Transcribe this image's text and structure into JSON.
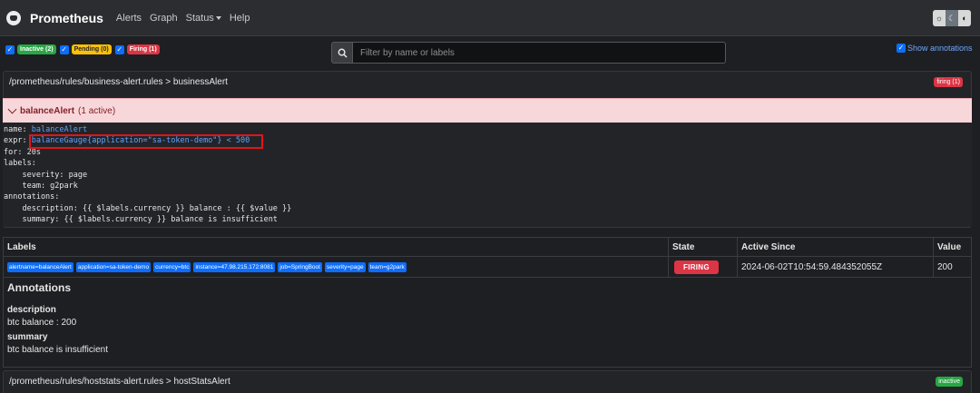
{
  "navbar": {
    "brand": "Prometheus",
    "items": [
      "Alerts",
      "Graph",
      "Status",
      "Help"
    ]
  },
  "filters": {
    "inactive": "Inactive (2)",
    "pending": "Pending (0)",
    "firing": "Firing (1)"
  },
  "search": {
    "placeholder": "Filter by name or labels"
  },
  "show_annotations": "Show annotations",
  "group1": {
    "path": "/prometheus/rules/business-alert.rules > businessAlert",
    "badge": "firing (1)"
  },
  "alert": {
    "name": "balanceAlert",
    "active": "(1 active)"
  },
  "rule": {
    "name_key": "name:",
    "name_val": "balanceAlert",
    "expr_key": "expr:",
    "expr_val": "balanceGauge{application=\"sa-token-demo\"} < 500",
    "for_line": "for: 20s",
    "labels_line": "labels:",
    "severity_line": "    severity: page",
    "team_line": "    team: g2park",
    "annotations_line": "annotations:",
    "description_line": "    description: {{ $labels.currency }} balance : {{ $value }}",
    "summary_line": "    summary: {{ $labels.currency }} balance is insufficient"
  },
  "table": {
    "headers": {
      "labels": "Labels",
      "state": "State",
      "active_since": "Active Since",
      "value": "Value"
    },
    "row": {
      "labels": [
        "alertname=balanceAlert",
        "application=sa-token-demo",
        "currency=btc",
        "instance=47.98.215.172:8081",
        "job=SpringBoot",
        "severity=page",
        "team=g2park"
      ],
      "state": "FIRING",
      "active_since": "2024-06-02T10:54:59.484352055Z",
      "value": "200"
    },
    "annotations": {
      "title": "Annotations",
      "description_key": "description",
      "description_val": "btc balance : 200",
      "summary_key": "summary",
      "summary_val": "btc balance is insufficient"
    }
  },
  "group2": {
    "path": "/prometheus/rules/hoststats-alert.rules > hostStatsAlert",
    "badge": "inactive"
  },
  "colors": {
    "firing": "#dc3545",
    "inactive": "#28a745",
    "pending": "#ffc107",
    "accent": "#0d6efd"
  }
}
